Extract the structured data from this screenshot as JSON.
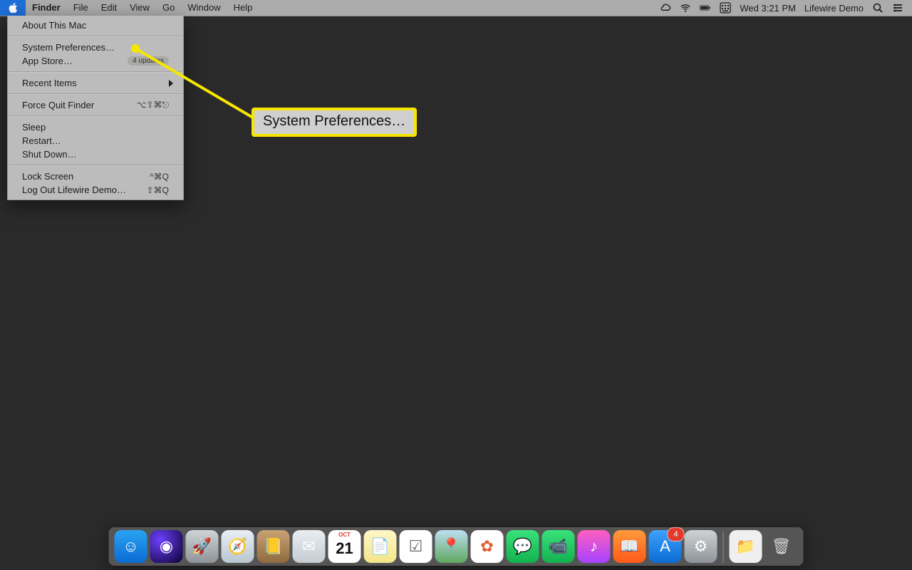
{
  "menubar": {
    "app": "Finder",
    "items": [
      "File",
      "Edit",
      "View",
      "Go",
      "Window",
      "Help"
    ],
    "right": {
      "clock": "Wed 3:21 PM",
      "user": "Lifewire Demo"
    }
  },
  "apple_menu": {
    "items": [
      {
        "label": "About This Mac"
      },
      {
        "sep": true
      },
      {
        "label": "System Preferences…"
      },
      {
        "label": "App Store…",
        "badge": "4 updates"
      },
      {
        "sep": true
      },
      {
        "label": "Recent Items",
        "submenu": true
      },
      {
        "sep": true
      },
      {
        "label": "Force Quit Finder",
        "shortcut": "⌥⇧⌘⎋"
      },
      {
        "sep": true
      },
      {
        "label": "Sleep"
      },
      {
        "label": "Restart…"
      },
      {
        "label": "Shut Down…"
      },
      {
        "sep": true
      },
      {
        "label": "Lock Screen",
        "shortcut": "^⌘Q"
      },
      {
        "label": "Log Out Lifewire Demo…",
        "shortcut": "⇧⌘Q"
      }
    ]
  },
  "callout": {
    "text": "System Preferences…"
  },
  "dock": {
    "items": [
      {
        "name": "finder",
        "bg": "linear-gradient(#2aa3f4,#0a6bd1)",
        "glyph": "☺"
      },
      {
        "name": "siri",
        "bg": "radial-gradient(circle at 30% 30%,#6d40ff,#0b0030)",
        "glyph": "◉"
      },
      {
        "name": "launchpad",
        "bg": "linear-gradient(#cfd3d6,#8e9499)",
        "glyph": "🚀"
      },
      {
        "name": "safari",
        "bg": "linear-gradient(#e9f0f6,#b8c6d0)",
        "glyph": "🧭"
      },
      {
        "name": "contacts",
        "bg": "linear-gradient(#c9a274,#8f6a3e)",
        "glyph": "📒"
      },
      {
        "name": "mail",
        "bg": "linear-gradient(#e9eef2,#c4ccd2)",
        "glyph": "✉"
      },
      {
        "name": "calendar",
        "bg": "#fff",
        "glyph": "21",
        "text": "#111",
        "top": "OCT"
      },
      {
        "name": "notes",
        "bg": "linear-gradient(#fff7c8,#f4e489)",
        "glyph": "📄"
      },
      {
        "name": "reminders",
        "bg": "#fff",
        "glyph": "☑",
        "text": "#666"
      },
      {
        "name": "maps",
        "bg": "linear-gradient(#bddff2,#5fa860)",
        "glyph": "📍"
      },
      {
        "name": "photos",
        "bg": "#fff",
        "glyph": "✿",
        "text": "#e25b2a"
      },
      {
        "name": "messages",
        "bg": "linear-gradient(#39e27a,#12b14f)",
        "glyph": "💬"
      },
      {
        "name": "facetime",
        "bg": "linear-gradient(#39e27a,#12b14f)",
        "glyph": "📹"
      },
      {
        "name": "itunes",
        "bg": "linear-gradient(#ff5fbf,#a542ff)",
        "glyph": "♪"
      },
      {
        "name": "ibooks",
        "bg": "linear-gradient(#ff9a3a,#ff5a1a)",
        "glyph": "📖"
      },
      {
        "name": "appstore",
        "bg": "linear-gradient(#3ea2ff,#0a6bd1)",
        "glyph": "A",
        "badge": "4"
      },
      {
        "name": "system-preferences",
        "bg": "linear-gradient(#cfd3d6,#8e9499)",
        "glyph": "⚙"
      }
    ],
    "after_sep": [
      {
        "name": "downloads",
        "bg": "#efefef",
        "glyph": "📁",
        "text": "#555"
      },
      {
        "name": "trash",
        "bg": "transparent",
        "glyph": "🗑",
        "text": "#d8d8d8"
      }
    ]
  }
}
